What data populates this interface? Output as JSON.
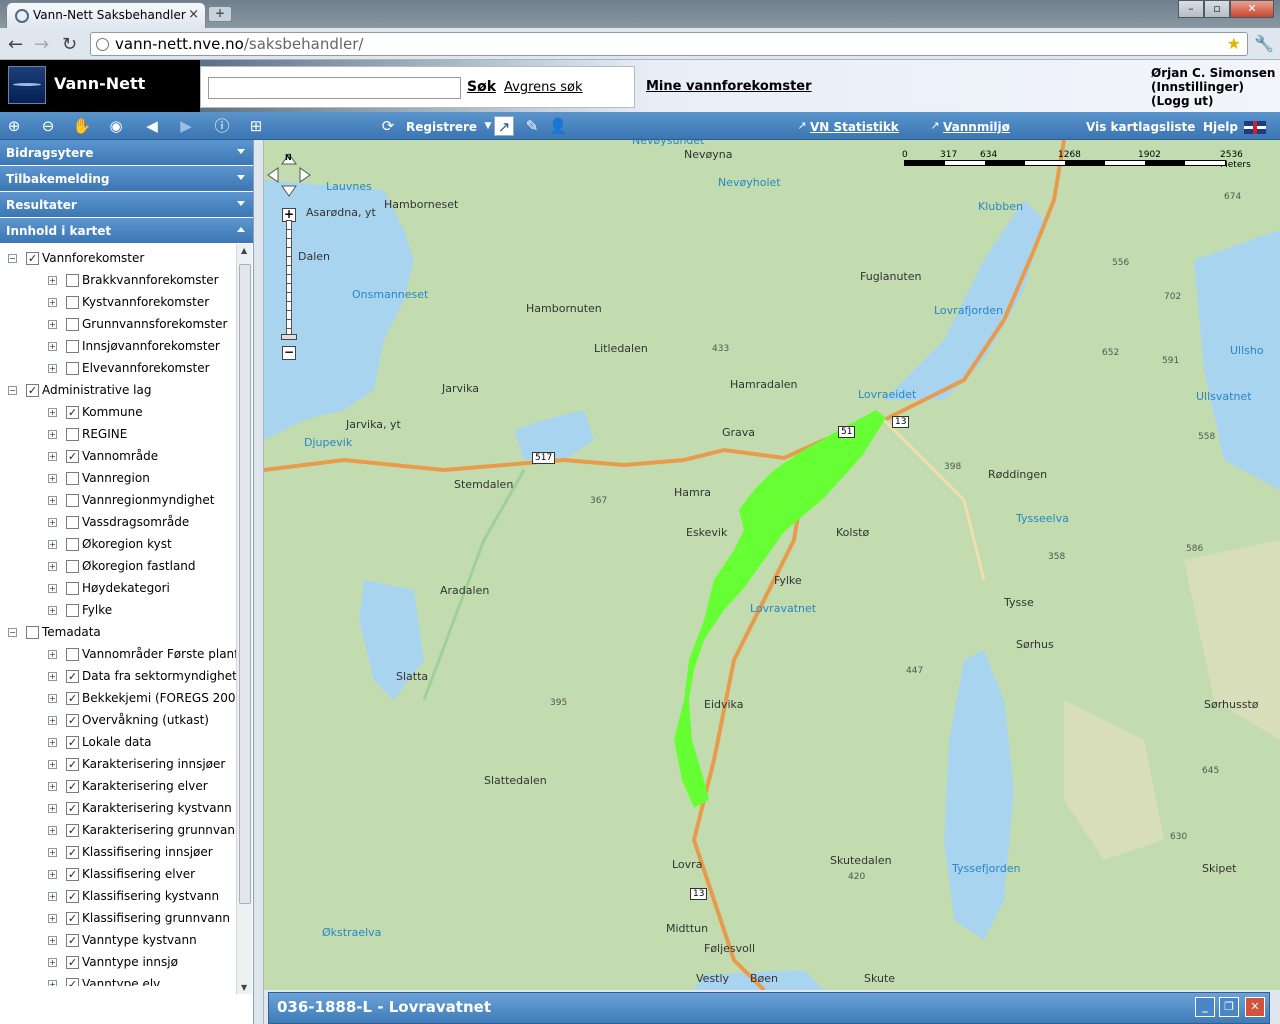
{
  "browser": {
    "tab_title": "Vann-Nett Saksbehandler",
    "tab_close": "×",
    "new_tab": "+",
    "url_host": "vann-nett.nve.no",
    "url_path": "/saksbehandler/",
    "window_buttons": [
      "–",
      "▫",
      "✕"
    ]
  },
  "header": {
    "app_name": "Vann-Nett",
    "search_value": "",
    "search_button": "Søk",
    "refine_search": "Avgrens søk",
    "my_waterbodies": "Mine vannforekomster",
    "user_name": "Ørjan C. Simonsen",
    "user_settings": "(Innstillinger)",
    "user_logout": "(Logg ut)"
  },
  "toolbar": {
    "register": "Registrere",
    "vn_stats": "VN Statistikk",
    "vannmiljo": "Vannmiljø",
    "layer_list": "Vis kartlagsliste",
    "help": "Hjelp",
    "icons": [
      "zoom-in-icon",
      "zoom-out-icon",
      "pan-hand-icon",
      "zoom-extent-icon",
      "back-arrow-icon",
      "forward-arrow-icon",
      "info-icon",
      "measure-icon",
      "register-icon",
      "draw-route-icon",
      "edit-pencil-icon",
      "add-user-icon"
    ]
  },
  "sidebar": {
    "panels": [
      "Bidragsytere",
      "Tilbakemelding",
      "Resultater",
      "Innhold i kartet"
    ],
    "tree": [
      {
        "level": 0,
        "label": "Vannforekomster",
        "checked": true,
        "exp": "−"
      },
      {
        "level": 1,
        "label": "Brakkvannforekomster",
        "checked": false,
        "exp": "+"
      },
      {
        "level": 1,
        "label": "Kystvannforekomster",
        "checked": false,
        "exp": "+"
      },
      {
        "level": 1,
        "label": "Grunnvannsforekomster",
        "checked": false,
        "exp": "+"
      },
      {
        "level": 1,
        "label": "Innsjøvannforekomster",
        "checked": false,
        "exp": "+"
      },
      {
        "level": 1,
        "label": "Elvevannforekomster",
        "checked": false,
        "exp": "+"
      },
      {
        "level": 0,
        "label": "Administrative lag",
        "checked": true,
        "exp": "−"
      },
      {
        "level": 1,
        "label": "Kommune",
        "checked": true,
        "exp": "+"
      },
      {
        "level": 1,
        "label": "REGINE",
        "checked": false,
        "exp": "+"
      },
      {
        "level": 1,
        "label": "Vannområde",
        "checked": true,
        "exp": "+"
      },
      {
        "level": 1,
        "label": "Vannregion",
        "checked": false,
        "exp": "+"
      },
      {
        "level": 1,
        "label": "Vannregionmyndighet",
        "checked": false,
        "exp": "+"
      },
      {
        "level": 1,
        "label": "Vassdragsområde",
        "checked": false,
        "exp": "+"
      },
      {
        "level": 1,
        "label": "Økoregion kyst",
        "checked": false,
        "exp": "+"
      },
      {
        "level": 1,
        "label": "Økoregion fastland",
        "checked": false,
        "exp": "+"
      },
      {
        "level": 1,
        "label": "Høydekategori",
        "checked": false,
        "exp": "+"
      },
      {
        "level": 1,
        "label": "Fylke",
        "checked": false,
        "exp": "+"
      },
      {
        "level": 0,
        "label": "Temadata",
        "checked": false,
        "exp": "−"
      },
      {
        "level": 1,
        "label": "Vannområder Første planfa",
        "checked": false,
        "exp": "+"
      },
      {
        "level": 1,
        "label": "Data fra sektormyndighete",
        "checked": true,
        "exp": "+"
      },
      {
        "level": 1,
        "label": "Bekkekjemi (FOREGS 2008",
        "checked": true,
        "exp": "+"
      },
      {
        "level": 1,
        "label": "Overvåkning (utkast)",
        "checked": true,
        "exp": "+"
      },
      {
        "level": 1,
        "label": "Lokale data",
        "checked": true,
        "exp": "+"
      },
      {
        "level": 1,
        "label": "Karakterisering innsjøer",
        "checked": true,
        "exp": "+"
      },
      {
        "level": 1,
        "label": "Karakterisering elver",
        "checked": true,
        "exp": "+"
      },
      {
        "level": 1,
        "label": "Karakterisering kystvann",
        "checked": true,
        "exp": "+"
      },
      {
        "level": 1,
        "label": "Karakterisering grunnvann",
        "checked": true,
        "exp": "+"
      },
      {
        "level": 1,
        "label": "Klassifisering innsjøer",
        "checked": true,
        "exp": "+"
      },
      {
        "level": 1,
        "label": "Klassifisering elver",
        "checked": true,
        "exp": "+"
      },
      {
        "level": 1,
        "label": "Klassifisering kystvann",
        "checked": true,
        "exp": "+"
      },
      {
        "level": 1,
        "label": "Klassifisering grunnvann",
        "checked": true,
        "exp": "+"
      },
      {
        "level": 1,
        "label": "Vanntype kystvann",
        "checked": true,
        "exp": "+"
      },
      {
        "level": 1,
        "label": "Vanntype innsjø",
        "checked": true,
        "exp": "+"
      },
      {
        "level": 1,
        "label": "Vanntype elv",
        "checked": true,
        "exp": "+"
      }
    ]
  },
  "map": {
    "scale_labels": [
      "0",
      "317",
      "634",
      "1268",
      "1902",
      "2536 Meters"
    ],
    "north_label": "N",
    "places": [
      "Nevøyna",
      "Asarødna, yt",
      "Hamborneset",
      "Dalen",
      "Hambornuten",
      "Fuglanuten",
      "Litledalen",
      "Hamradalen",
      "Jarvika",
      "Jarvika, yt",
      "Grava",
      "Stemdalen",
      "Hamra",
      "Kolstø",
      "Røddingen",
      "Eskevik",
      "Fylke",
      "Aradalen",
      "Tysse",
      "Sørhus",
      "Slatta",
      "Eidvika",
      "Slattedalen",
      "Skutedalen",
      "Lovra",
      "Midttun",
      "Føljesvoll",
      "Vestly",
      "Bøen",
      "Skute",
      "Sørhusstø",
      "Skipet"
    ],
    "waters": [
      "Nevøysundet",
      "Lauvnes",
      "Nevøyholet",
      "Klubben",
      "Onsmanneset",
      "Lovrafjorden",
      "Ullsho",
      "Ullsvatnet",
      "Lovraeidet",
      "Djupevik",
      "Tysseelva",
      "Tyssefjorden",
      "Økstraelva",
      "Lovravatnet"
    ],
    "elevations": [
      "674",
      "556",
      "702",
      "652",
      "591",
      "433",
      "558",
      "398",
      "367",
      "586",
      "358",
      "447",
      "395",
      "645",
      "420",
      "630"
    ],
    "roads": [
      "517",
      "51",
      "13",
      "13"
    ],
    "highlight_color": "#66ff33"
  },
  "info_panel": {
    "title": "036-1888-L - Lovravatnet",
    "buttons": [
      "_",
      "❐",
      "✕"
    ]
  }
}
